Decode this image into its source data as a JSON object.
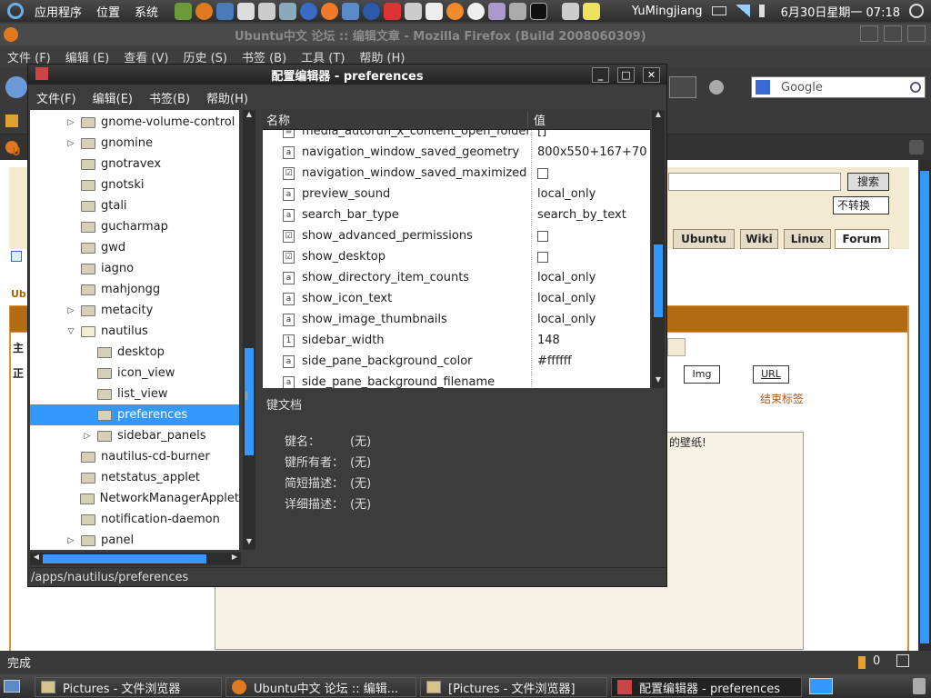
{
  "top_panel": {
    "menus": [
      "应用程序",
      "位置",
      "系统"
    ],
    "user": "YuMingjiang",
    "datetime": "6月30日星期一  07:18"
  },
  "firefox": {
    "title": "Ubuntu中文 论坛 :: 编辑文章 - Mozilla Firefox (Build 2008060309)",
    "menus": [
      "文件 (F)",
      "编辑 (E)",
      "查看 (V)",
      "历史 (S)",
      "书签 (B)",
      "工具 (T)",
      "帮助 (H)"
    ],
    "search_placeholder": "Google",
    "status": "完成",
    "status_count": "0",
    "page": {
      "search_btn": "搜索",
      "convert_select": "不转换",
      "tabs": [
        "Ubuntu",
        "Wiki",
        "Linux",
        "Forum"
      ],
      "btn_img": "Img",
      "btn_url": "URL",
      "end_tag": "结束标签",
      "text_frag": "的壁纸!",
      "frag_u": "U",
      "frag_ub": "Ub",
      "frag_zhu": "主",
      "frag_zheng": "正"
    }
  },
  "taskbar": {
    "items": [
      "Pictures - 文件浏览器",
      "Ubuntu中文 论坛 :: 编辑...",
      "[Pictures - 文件浏览器]",
      "配置编辑器 - preferences"
    ]
  },
  "dialog": {
    "title": "配置编辑器 - preferences",
    "menus": [
      "文件(F)",
      "编辑(E)",
      "书签(B)",
      "帮助(H)"
    ],
    "tree": [
      {
        "label": "gnome-volume-control",
        "indent": 1,
        "expander": "collapsed"
      },
      {
        "label": "gnomine",
        "indent": 1,
        "expander": "collapsed"
      },
      {
        "label": "gnotravex",
        "indent": 1,
        "expander": "none"
      },
      {
        "label": "gnotski",
        "indent": 1,
        "expander": "none"
      },
      {
        "label": "gtali",
        "indent": 1,
        "expander": "none"
      },
      {
        "label": "gucharmap",
        "indent": 1,
        "expander": "none"
      },
      {
        "label": "gwd",
        "indent": 1,
        "expander": "none"
      },
      {
        "label": "iagno",
        "indent": 1,
        "expander": "none"
      },
      {
        "label": "mahjongg",
        "indent": 1,
        "expander": "none"
      },
      {
        "label": "metacity",
        "indent": 1,
        "expander": "collapsed"
      },
      {
        "label": "nautilus",
        "indent": 1,
        "expander": "expanded"
      },
      {
        "label": "desktop",
        "indent": 2,
        "expander": "none"
      },
      {
        "label": "icon_view",
        "indent": 2,
        "expander": "none"
      },
      {
        "label": "list_view",
        "indent": 2,
        "expander": "none"
      },
      {
        "label": "preferences",
        "indent": 2,
        "expander": "none",
        "selected": true
      },
      {
        "label": "sidebar_panels",
        "indent": 2,
        "expander": "collapsed"
      },
      {
        "label": "nautilus-cd-burner",
        "indent": 1,
        "expander": "none"
      },
      {
        "label": "netstatus_applet",
        "indent": 1,
        "expander": "none"
      },
      {
        "label": "NetworkManagerApplet",
        "indent": 1,
        "expander": "none"
      },
      {
        "label": "notification-daemon",
        "indent": 1,
        "expander": "none"
      },
      {
        "label": "panel",
        "indent": 1,
        "expander": "collapsed"
      }
    ],
    "list_headers": {
      "name": "名称",
      "value": "值"
    },
    "keys": [
      {
        "name": "media_autorun_x_content_open_folder",
        "value": "[]",
        "type": "list"
      },
      {
        "name": "navigation_window_saved_geometry",
        "value": "800x550+167+70",
        "type": "string"
      },
      {
        "name": "navigation_window_saved_maximized",
        "value": "",
        "type": "bool"
      },
      {
        "name": "preview_sound",
        "value": "local_only",
        "type": "string"
      },
      {
        "name": "search_bar_type",
        "value": "search_by_text",
        "type": "string"
      },
      {
        "name": "show_advanced_permissions",
        "value": "",
        "type": "bool"
      },
      {
        "name": "show_desktop",
        "value": "",
        "type": "bool"
      },
      {
        "name": "show_directory_item_counts",
        "value": "local_only",
        "type": "string"
      },
      {
        "name": "show_icon_text",
        "value": "local_only",
        "type": "string"
      },
      {
        "name": "show_image_thumbnails",
        "value": "local_only",
        "type": "string"
      },
      {
        "name": "sidebar_width",
        "value": "148",
        "type": "int"
      },
      {
        "name": "side_pane_background_color",
        "value": "#ffffff",
        "type": "string"
      },
      {
        "name": "side_pane_background_filename",
        "value": "",
        "type": "string"
      }
    ],
    "doc": {
      "title": "键文档",
      "rows": [
        {
          "label": "键名：",
          "value": "(无)"
        },
        {
          "label": "键所有者：",
          "value": "(无)"
        },
        {
          "label": "简短描述：",
          "value": "(无)"
        },
        {
          "label": "详细描述：",
          "value": "(无)"
        }
      ]
    },
    "status_path": "/apps/nautilus/preferences"
  },
  "colors": {
    "selection": "#3399ff",
    "panel": "#3c3c3c",
    "web_brown": "#b36b12"
  }
}
